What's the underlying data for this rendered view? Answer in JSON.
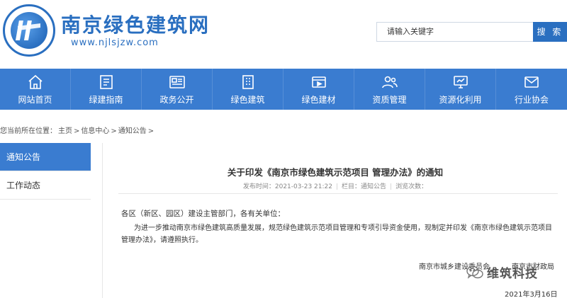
{
  "header": {
    "site_title": "南京绿色建筑网",
    "site_url": "www.njlsjzw.com",
    "search_placeholder": "请输入关键字",
    "search_button": "搜 索"
  },
  "nav": {
    "items": [
      {
        "label": "网站首页",
        "icon": "home-icon"
      },
      {
        "label": "绿建指南",
        "icon": "book-icon"
      },
      {
        "label": "政务公开",
        "icon": "newspaper-icon"
      },
      {
        "label": "绿色建筑",
        "icon": "building-icon"
      },
      {
        "label": "绿色建材",
        "icon": "video-icon"
      },
      {
        "label": "资质管理",
        "icon": "users-icon"
      },
      {
        "label": "资源化利用",
        "icon": "monitor-icon"
      },
      {
        "label": "行业协会",
        "icon": "mail-icon"
      }
    ]
  },
  "breadcrumb": {
    "items": [
      "您当前所在位置：",
      "主页",
      ">",
      "信息中心",
      ">",
      "通知公告",
      ">"
    ]
  },
  "sidebar": {
    "items": [
      {
        "label": "通知公告",
        "active": true
      },
      {
        "label": "工作动态",
        "active": false
      }
    ]
  },
  "article": {
    "title": "关于印发《南京市绿色建筑示范项目 管理办法》的通知",
    "published": "发布时间：2021-03-23 21:22",
    "column": "栏目：通知公告",
    "views": "浏览次数：",
    "salutation": "各区（新区、园区）建设主管部门，各有关单位：",
    "body": "为进一步推动南京市绿色建筑高质量发展，规范绿色建筑示范项目管理和专项引导资金使用，现制定并印发《南京市绿色建筑示范项目管理办法》，请遵照执行。",
    "signature_left": "南京市城乡建设委员会",
    "signature_right": "南京市财政局",
    "date": "2021年3月16日"
  },
  "watermark": {
    "text": "维筑科技"
  },
  "colors": {
    "brand_blue": "#3a7cd0",
    "logo_blue": "#2a6fc0"
  }
}
